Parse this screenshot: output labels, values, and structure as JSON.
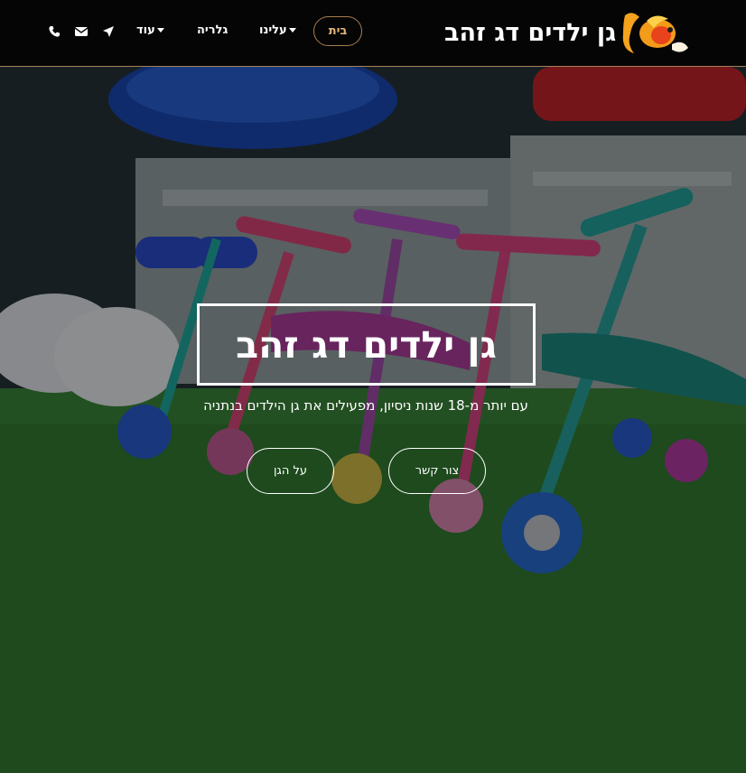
{
  "brand": {
    "name": "גן ילדים דג זהב"
  },
  "nav": {
    "home": "בית",
    "about": "עלינו",
    "gallery": "גלריה",
    "more": "עוד",
    "icons": [
      "location-arrow-icon",
      "envelope-icon",
      "phone-icon"
    ]
  },
  "hero": {
    "title": "גן ילדים דג זהב",
    "subtitle": "עם יותר מ-18 שנות ניסיון, מפעילים את גן הילדים בנתניה",
    "contact_button": "צור קשר",
    "about_button": "על הגן"
  },
  "colors": {
    "nav_background": "#050506",
    "accent": "#e0b57b",
    "accent_border": "#a77e4f"
  }
}
